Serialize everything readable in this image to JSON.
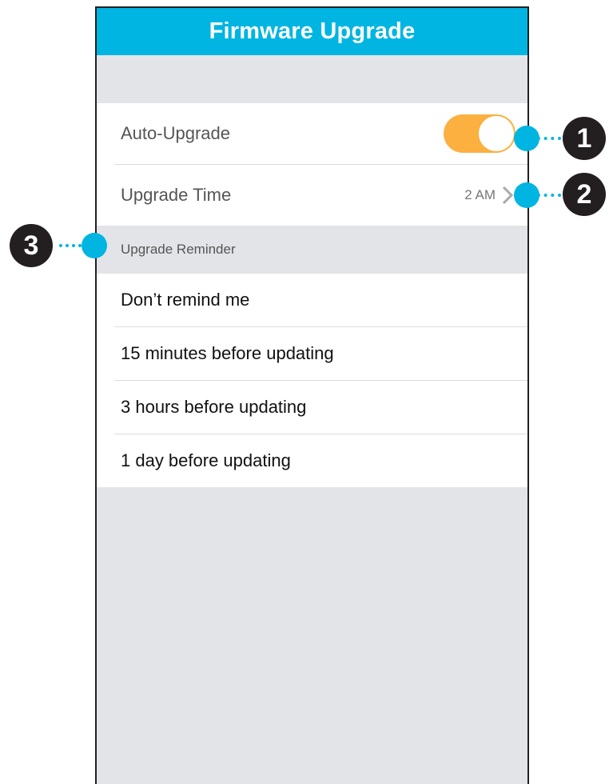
{
  "colors": {
    "header_bg": "#00b5e2",
    "toggle_on": "#fbb040",
    "callout_dot": "#00b5e2",
    "callout_badge": "#231f20"
  },
  "header": {
    "title": "Firmware Upgrade"
  },
  "settings": {
    "auto_upgrade": {
      "label": "Auto-Upgrade",
      "enabled": true
    },
    "upgrade_time": {
      "label": "Upgrade Time",
      "value": "2 AM",
      "icon": "chevron-right-icon"
    }
  },
  "reminder": {
    "section_label": "Upgrade Reminder",
    "options": [
      {
        "label": "Don’t remind me"
      },
      {
        "label": "15 minutes before updating"
      },
      {
        "label": "3 hours before updating"
      },
      {
        "label": "1 day before updating"
      }
    ]
  },
  "callouts": [
    "1",
    "2",
    "3"
  ]
}
